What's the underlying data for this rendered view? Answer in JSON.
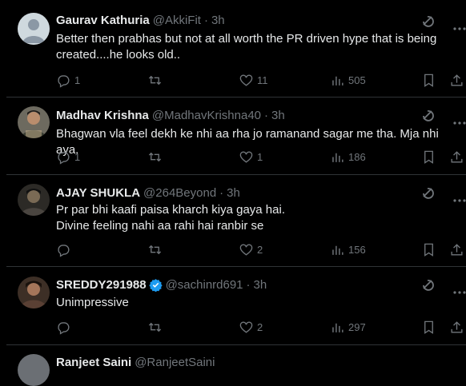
{
  "tweets": [
    {
      "name": "Gaurav Kathuria",
      "handle": "@AkkiFit",
      "time": "3h",
      "text": "Better then prabhas but not at all worth the PR driven hype that is being created....he looks old..",
      "replies": "1",
      "retweets": "",
      "likes": "11",
      "views": "505",
      "verified": false
    },
    {
      "name": "Madhav Krishna",
      "handle": "@MadhavKrishna40",
      "time": "3h",
      "text": "Bhagwan vla feel dekh ke nhi aa rha jo ramanand sagar me tha. Mja nhi aya.",
      "replies": "1",
      "retweets": "",
      "likes": "1",
      "views": "186",
      "verified": false
    },
    {
      "name": "AJAY SHUKLA",
      "handle": "@264Beyond",
      "time": "3h",
      "text": "Pr par bhi kaafi paisa kharch kiya gaya hai.\nDivine feeling nahi aa rahi hai ranbir se",
      "replies": "",
      "retweets": "",
      "likes": "2",
      "views": "156",
      "verified": false
    },
    {
      "name": "SREDDY291988",
      "handle": "@sachinrd691",
      "time": "3h",
      "text": "Unimpressive",
      "replies": "",
      "retweets": "",
      "likes": "2",
      "views": "297",
      "verified": true
    }
  ],
  "partial_next": {
    "name": "Ranjeet Saini",
    "handle": "@RanjeetSaini"
  },
  "icons": {
    "reply": "reply-icon",
    "retweet": "retweet-icon",
    "like": "heart-icon",
    "views": "views-icon",
    "bookmark": "bookmark-icon",
    "share": "share-icon",
    "grok": "grok-icon",
    "more": "more-icon",
    "verified": "verified-badge-icon"
  },
  "colors": {
    "background": "#000000",
    "text": "#e7e9ea",
    "muted": "#71767b",
    "border": "#2f3336",
    "verified": "#1d9bf0"
  }
}
